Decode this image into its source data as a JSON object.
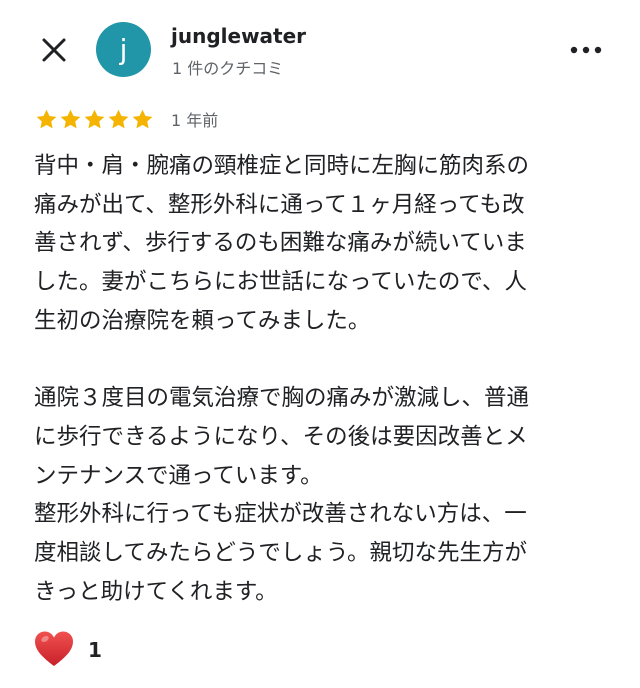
{
  "header": {
    "avatar_letter": "j",
    "user_name": "junglewater",
    "review_count": "1 件のクチコミ"
  },
  "rating": {
    "stars": 5,
    "max_stars": 5,
    "star_color": "#F4B400",
    "time_ago": "1 年前"
  },
  "review": {
    "lines_p1": [
      "背中・肩・腕痛の頸椎症と同時に左胸に筋肉系の",
      "痛みが出て、整形外科に通って１ヶ月経っても改",
      "善されず、歩行するのも困難な痛みが続いていま",
      "した。妻がこちらにお世話になっていたので、人",
      "生初の治療院を頼ってみました。"
    ],
    "lines_p2": [
      "通院３度目の電気治療で胸の痛みが激減し、普通",
      "に歩行できるようになり、その後は要因改善とメ",
      "ンテナンスで通っています。",
      "整形外科に行っても症状が改善されない方は、一",
      "度相談してみたらどうでしょう。親切な先生方が",
      "きっと助けてくれます。"
    ]
  },
  "reaction": {
    "icon": "heart-icon",
    "count": "1"
  },
  "colors": {
    "avatar_bg": "#2196A8",
    "heart": "#E53935",
    "secondary_text": "#5F6368"
  }
}
